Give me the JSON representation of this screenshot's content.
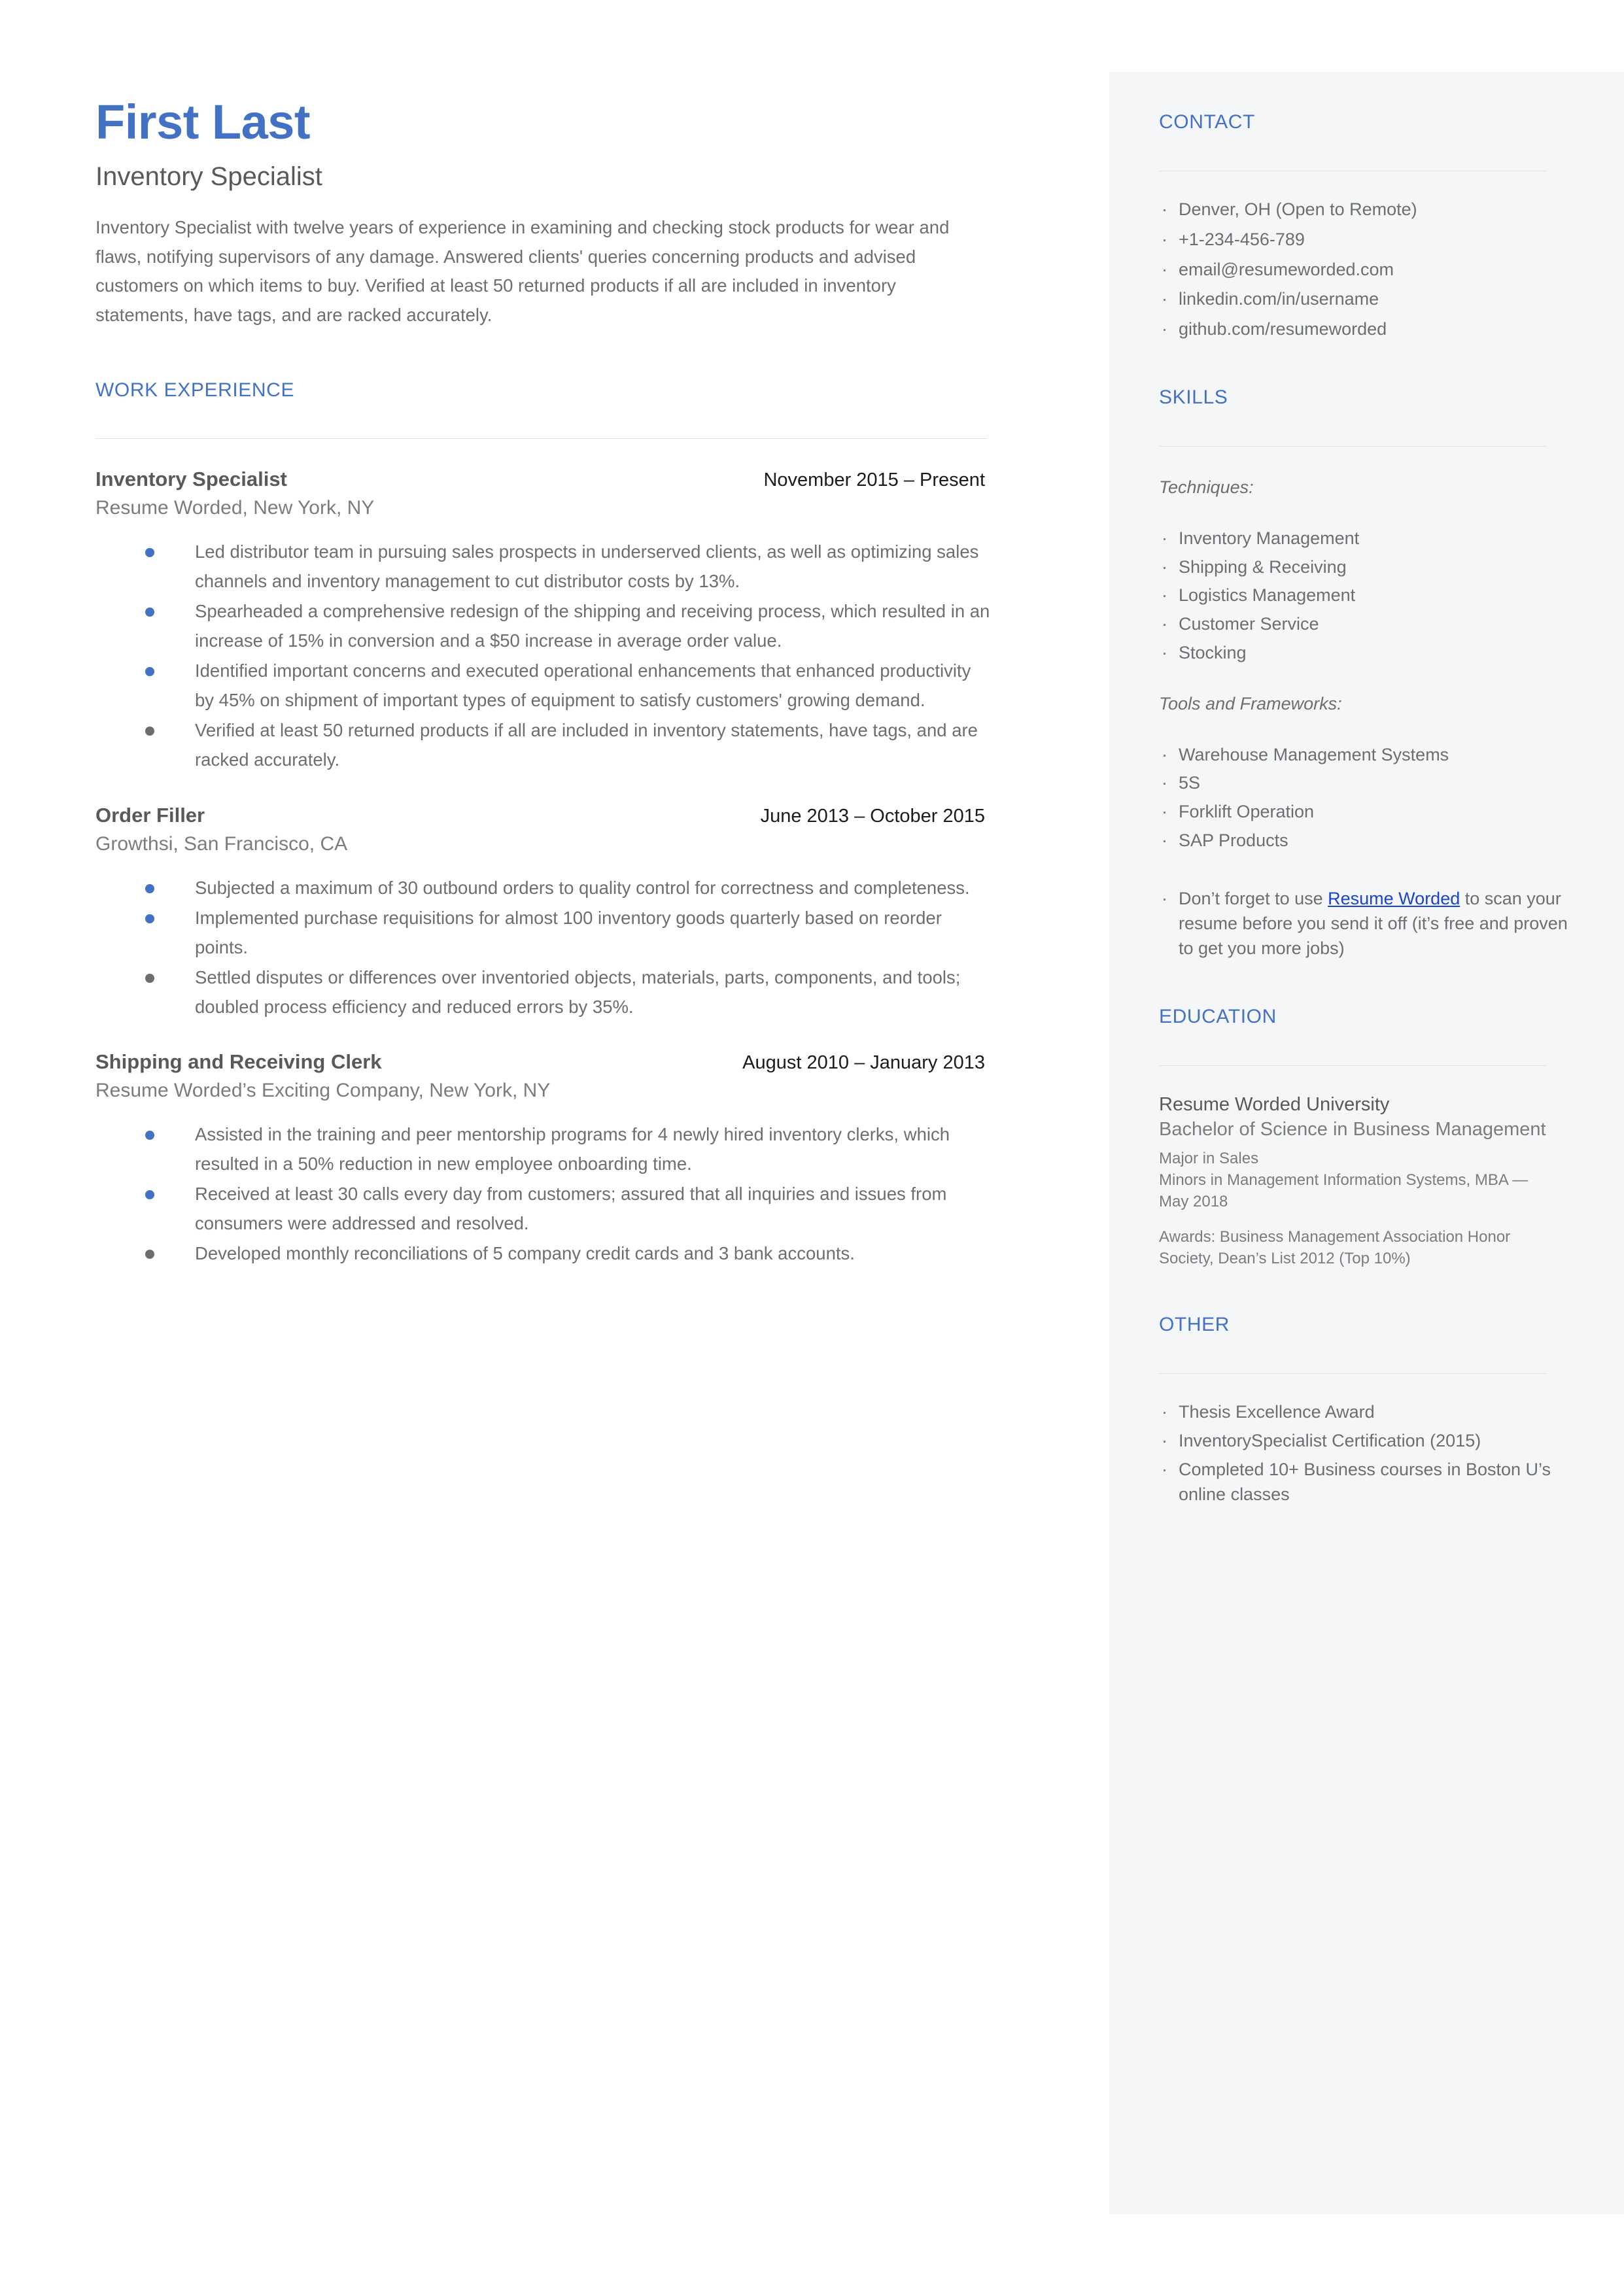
{
  "colors": {
    "accent": "#4372c4",
    "sidebar_bg": "#f4f6f8",
    "body_text": "#6c6e70",
    "heading_text": "#58595b",
    "link": "#1a43d0",
    "rule": "#dfe1e3"
  },
  "header": {
    "name": "First Last",
    "headline": "Inventory Specialist",
    "summary": "Inventory Specialist with twelve years of experience in examining and checking stock products for wear and flaws, notifying supervisors of any damage. Answered clients' queries concerning products and advised customers on which items to buy. Verified at least 50 returned products if all are included in inventory statements, have tags, and are racked accurately."
  },
  "work_experience": {
    "section_title": "WORK EXPERIENCE",
    "jobs": [
      {
        "title": "Inventory Specialist",
        "dates": "November 2015 – Present",
        "company": "Resume Worded, New York, NY",
        "bullets": [
          {
            "text": "Led distributor team in pursuing sales prospects in underserved clients, as well as optimizing sales channels and inventory management to cut distributor costs by 13%.",
            "dot": "blue"
          },
          {
            "text": "Spearheaded a comprehensive redesign of the shipping and receiving process, which resulted in an increase of 15% in conversion and a $50 increase in average order value.",
            "dot": "blue"
          },
          {
            "text": "Identified important concerns and executed operational enhancements that enhanced productivity by 45% on shipment of important types of equipment to satisfy customers' growing demand.",
            "dot": "blue"
          },
          {
            "text": "Verified at least 50 returned products if all are included in inventory statements, have tags, and are racked accurately.",
            "dot": "gray"
          }
        ]
      },
      {
        "title": "Order Filler",
        "dates": "June 2013 – October 2015",
        "company": "Growthsi, San Francisco, CA",
        "bullets": [
          {
            "text": "Subjected a maximum of 30 outbound orders to quality control for correctness and completeness.",
            "dot": "blue"
          },
          {
            "text": "Implemented purchase requisitions for almost 100 inventory goods quarterly based on reorder points.",
            "dot": "blue"
          },
          {
            "text": "Settled disputes or differences over inventoried objects, materials, parts, components, and tools; doubled process efficiency and reduced errors by 35%.",
            "dot": "gray"
          }
        ]
      },
      {
        "title": "Shipping and Receiving Clerk",
        "dates": "August 2010 – January 2013",
        "company": "Resume Worded’s Exciting Company, New York, NY",
        "bullets": [
          {
            "text": "Assisted in the training and peer mentorship programs for 4 newly hired inventory clerks, which resulted in a 50% reduction in new employee onboarding time.",
            "dot": "blue"
          },
          {
            "text": "Received at least 30 calls every day from customers; assured that all inquiries and issues from consumers were addressed and resolved.",
            "dot": "blue"
          },
          {
            "text": "Developed monthly reconciliations of 5 company credit cards and 3 bank accounts.",
            "dot": "gray"
          }
        ]
      }
    ]
  },
  "sidebar": {
    "contact": {
      "title": "CONTACT",
      "items": [
        " Denver, OH (Open to Remote)",
        "+1-234-456-789",
        "email@resumeworded.com",
        "linkedin.com/in/username",
        "github.com/resumeworded"
      ]
    },
    "skills": {
      "title": "SKILLS",
      "groups": [
        {
          "label": "Techniques:",
          "items": [
            "Inventory Management",
            "Shipping & Receiving",
            "Logistics Management",
            "Customer Service",
            "Stocking"
          ]
        },
        {
          "label": "Tools and Frameworks:",
          "items": [
            " Warehouse Management Systems",
            " 5S",
            "Forklift Operation",
            "SAP Products"
          ]
        }
      ],
      "note": {
        "before_link": " Don’t forget to use ",
        "link_text": "Resume Worded",
        "after_link": " to scan your resume before you send it off (it’s free and proven to get you more jobs)"
      }
    },
    "education": {
      "title": "EDUCATION",
      "school": "Resume Worded University",
      "degree": "Bachelor of Science in Business Management",
      "detail_lines": [
        "Major in Sales",
        "Minors in Management Information Systems, MBA — May 2018"
      ],
      "awards": "Awards: Business Management Association Honor Society, Dean’s List 2012 (Top 10%)"
    },
    "other": {
      "title": "OTHER",
      "items": [
        " Thesis Excellence Award",
        " InventorySpecialist Certification (2015)",
        " Completed 10+ Business courses in Boston U’s online classes"
      ]
    }
  }
}
